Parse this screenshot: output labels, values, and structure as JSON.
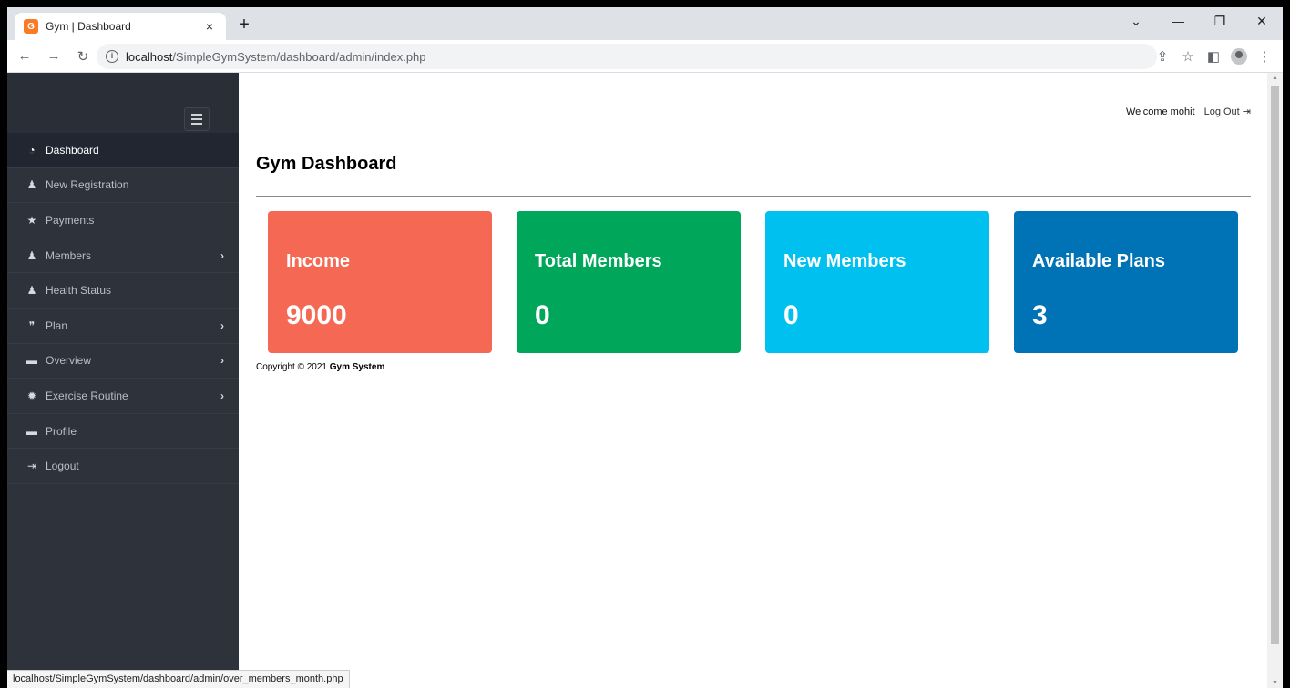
{
  "browser": {
    "tab_title": "Gym | Dashboard",
    "tab_close": "×",
    "new_tab": "+",
    "url_host": "localhost",
    "url_path": "/SimpleGymSystem/dashboard/admin/index.php",
    "status_url": "localhost/SimpleGymSystem/dashboard/admin/over_members_month.php",
    "favicon_text": "G"
  },
  "sidebar": {
    "items": [
      {
        "label": "Dashboard",
        "icon": "◔",
        "chevron": ""
      },
      {
        "label": "New Registration",
        "icon": "♟",
        "chevron": ""
      },
      {
        "label": "Payments",
        "icon": "★",
        "chevron": ""
      },
      {
        "label": "Members",
        "icon": "♟",
        "chevron": "›"
      },
      {
        "label": "Health Status",
        "icon": "♟",
        "chevron": ""
      },
      {
        "label": "Plan",
        "icon": "❞",
        "chevron": "›"
      },
      {
        "label": "Overview",
        "icon": "▬",
        "chevron": "›"
      },
      {
        "label": "Exercise Routine",
        "icon": "✹",
        "chevron": "›"
      },
      {
        "label": "Profile",
        "icon": "▬",
        "chevron": ""
      },
      {
        "label": "Logout",
        "icon": "⇥",
        "chevron": ""
      }
    ]
  },
  "header": {
    "welcome": "Welcome mohit",
    "logout": "Log Out"
  },
  "main": {
    "title": "Gym Dashboard",
    "cards": [
      {
        "title": "Income",
        "value": "9000",
        "color": "#f56954"
      },
      {
        "title": "Total Members",
        "value": "0",
        "color": "#00a65a"
      },
      {
        "title": "New Members",
        "value": "0",
        "color": "#00c0ef"
      },
      {
        "title": "Available Plans",
        "value": "3",
        "color": "#0073b7"
      }
    ],
    "copyright_prefix": "Copyright © 2021",
    "copyright_brand": "Gym System"
  }
}
